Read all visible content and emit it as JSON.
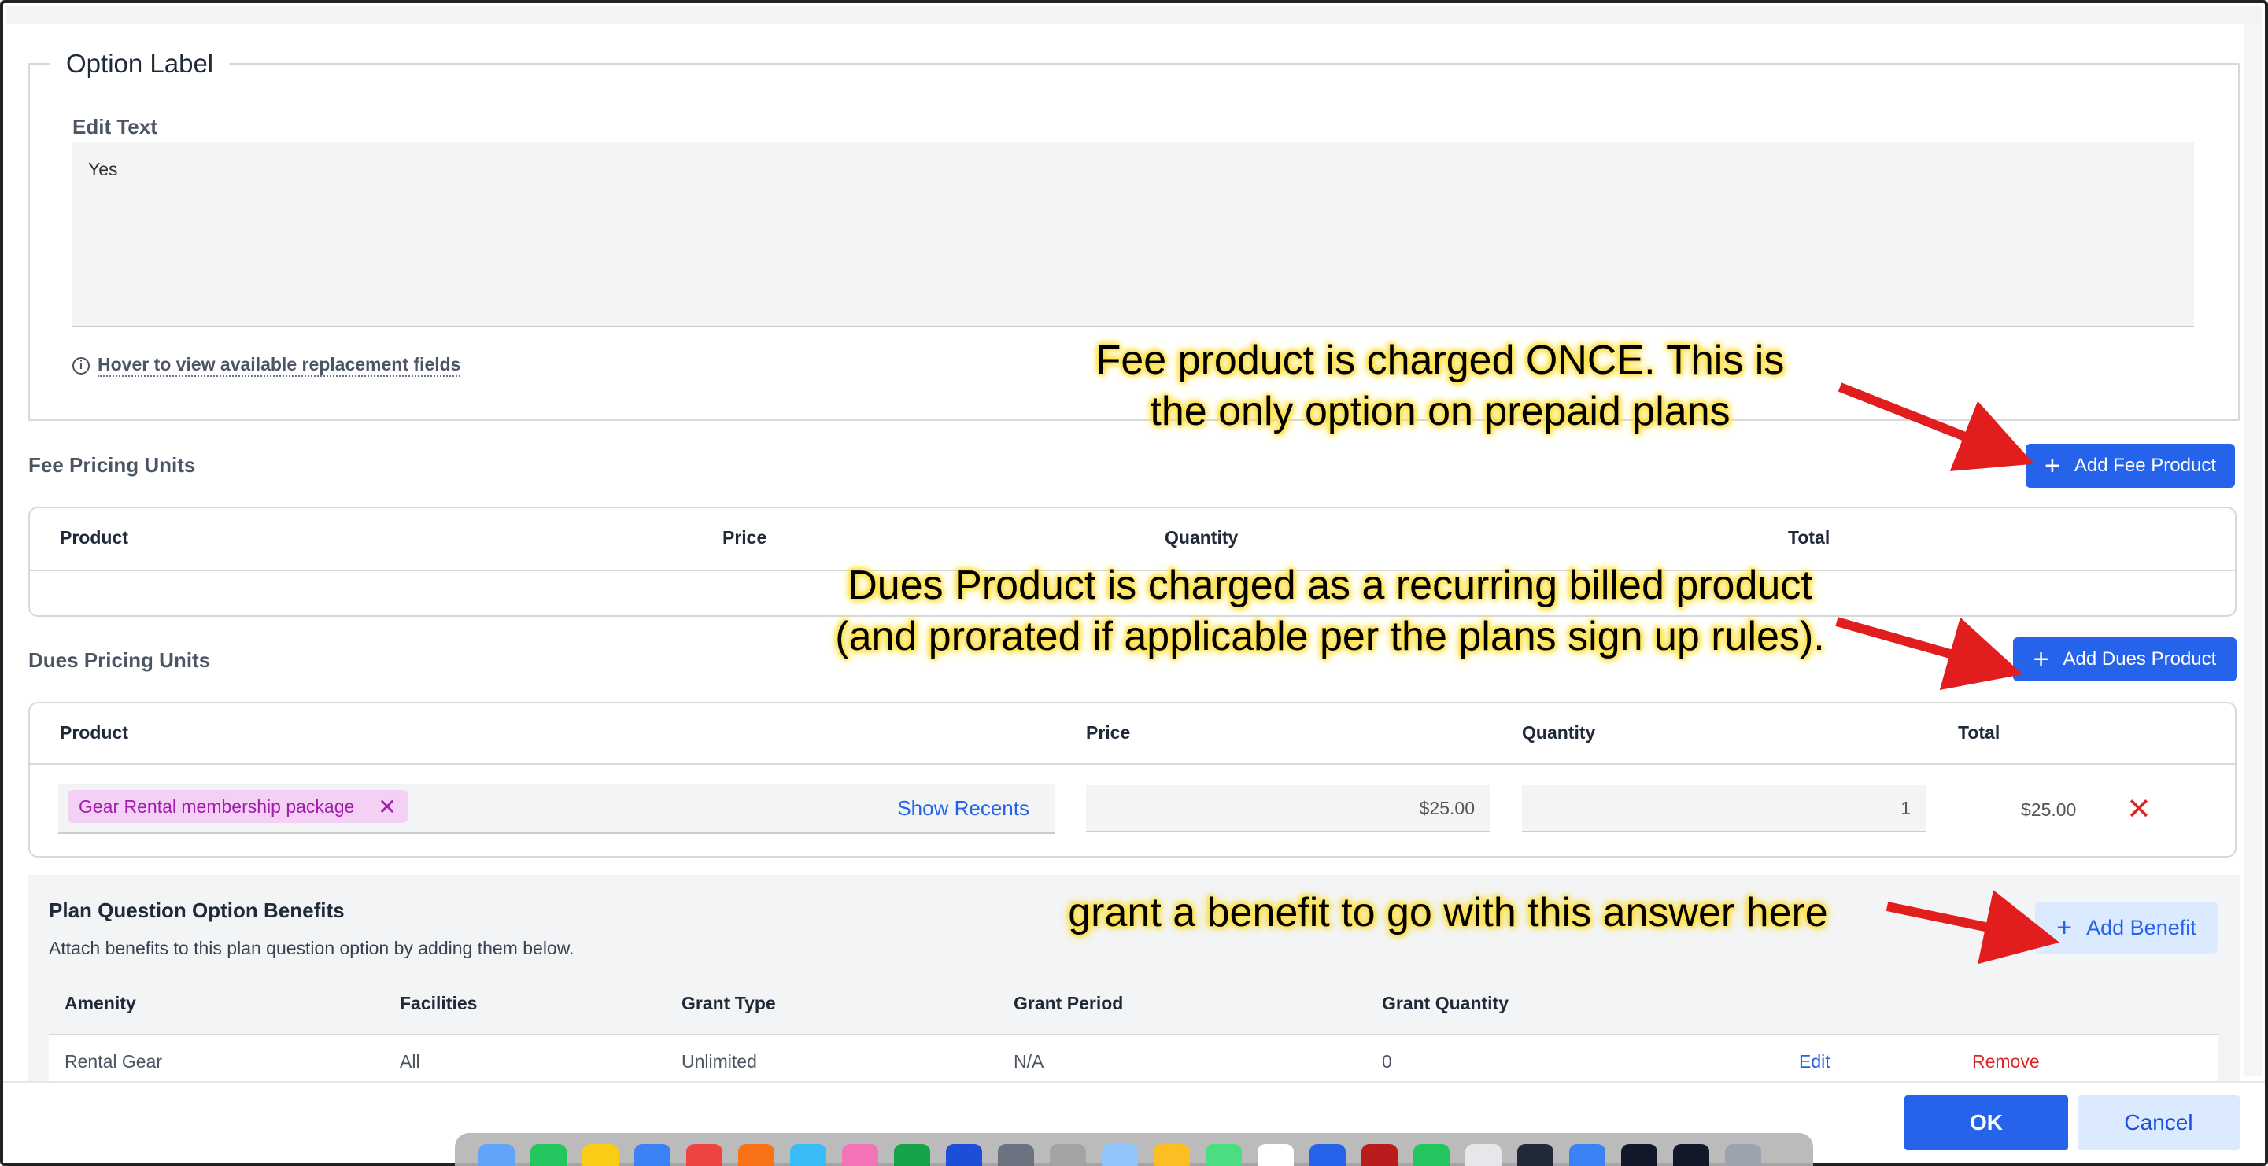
{
  "option_label": {
    "legend": "Option Label",
    "edit_text_label": "Edit Text",
    "edit_text_value": "Yes",
    "hover_link": "Hover to view available replacement fields"
  },
  "fee_pricing": {
    "title": "Fee Pricing Units",
    "add_button": "Add Fee Product",
    "columns": [
      "Product",
      "Price",
      "Quantity",
      "Total"
    ]
  },
  "dues_pricing": {
    "title": "Dues Pricing Units",
    "add_button": "Add Dues Product",
    "columns": [
      "Product",
      "Price",
      "Quantity",
      "Total"
    ],
    "row": {
      "product_chip": "Gear Rental membership package",
      "show_recents": "Show Recents",
      "price": "$25.00",
      "quantity": "1",
      "total": "$25.00"
    }
  },
  "benefits": {
    "title": "Plan Question Option Benefits",
    "subtitle": "Attach benefits to this plan question option by adding them below.",
    "add_button": "Add Benefit",
    "columns": [
      "Amenity",
      "Facilities",
      "Grant Type",
      "Grant Period",
      "Grant Quantity"
    ],
    "rows": [
      {
        "amenity": "Rental Gear",
        "facilities": "All",
        "grant_type": "Unlimited",
        "grant_period": "N/A",
        "grant_quantity": "0",
        "edit": "Edit",
        "remove": "Remove"
      }
    ]
  },
  "footer": {
    "ok": "OK",
    "cancel": "Cancel"
  },
  "annotations": {
    "fee_line1": "Fee product is charged ONCE. This is",
    "fee_line2": "the only option on prepaid plans",
    "dues_line1": "Dues Product is charged as a recurring billed product",
    "dues_line2": "(and prorated if applicable per the plans sign up rules).",
    "benefit": "grant a benefit to go with this answer here"
  },
  "colors": {
    "primary": "#2563eb",
    "primary_light": "#dbeafe",
    "danger": "#dc2626",
    "chip_bg": "#f5d0f5",
    "chip_text": "#a21caf",
    "annotation_arrow": "#e11d1d",
    "annotation_glow": "#fde047"
  },
  "icons": {
    "info": "info-circle-icon",
    "plus": "plus-icon",
    "remove_chip": "close-icon",
    "delete_row": "close-icon"
  }
}
